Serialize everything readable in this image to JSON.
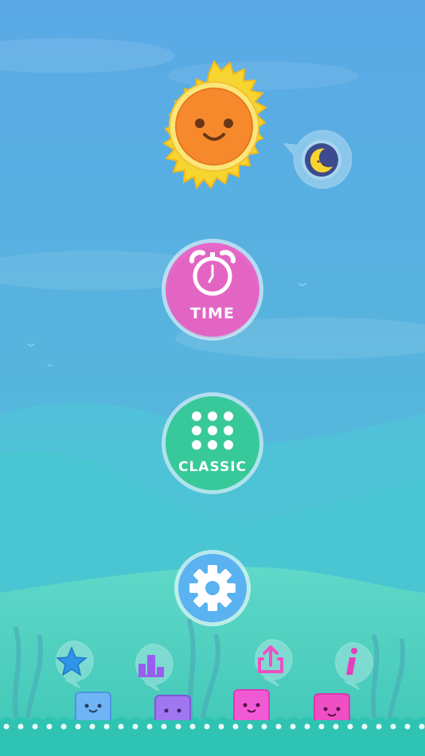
{
  "menu": {
    "time_label": "TIME",
    "classic_label": "CLASSIC"
  },
  "icons": {
    "theme_toggle": "moon-icon",
    "mascot": "smiling-sun-icon",
    "time": "alarm-clock-icon",
    "classic": "grid-dots-icon",
    "settings": "gear-icon",
    "rate": "star-icon",
    "leaderboard": "podium-icon",
    "share": "share-icon",
    "info": "info-icon"
  },
  "colors": {
    "time_button": "#e668c8",
    "classic_button": "#37c99a",
    "settings_button": "#5ab2f0",
    "sun_rays": "#f7d531",
    "sun_face": "#f6892b",
    "ground": "#2fc3b3",
    "square_blue": "#6fb4f5",
    "square_purple": "#a077f0",
    "square_pink": "#f15ad5",
    "square_magenta": "#f04fc4"
  }
}
